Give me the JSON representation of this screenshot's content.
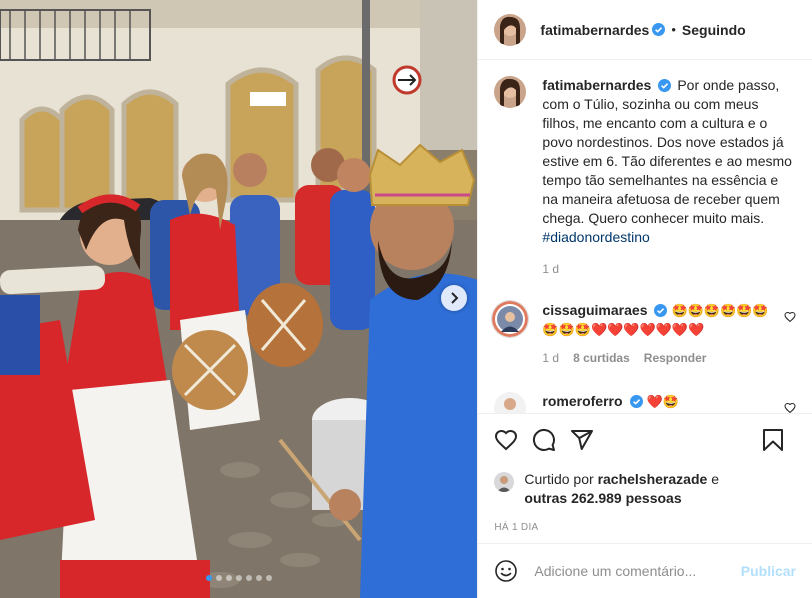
{
  "post": {
    "author": "fatimabernardes",
    "separator": "•",
    "follow_label": "Seguindo",
    "caption": {
      "text": "Por onde passo, com o Túlio, sozinha ou com meus filhos, me encanto com a cultura e o povo nordestinos. Dos nove estados já estive em 6. Tão diferentes e ao mesmo tempo tão semelhantes na essência e na maneira afetuosa de receber quem chega. Quero conhecer muito mais.",
      "hashtag": "#diadonordestino",
      "time": "1 d"
    },
    "comments": [
      {
        "user": "cissaguimaraes",
        "text": "🤩🤩🤩🤩🤩🤩🤩🤩🤩❤️❤️❤️❤️❤️❤️❤️",
        "time": "1 d",
        "likes": "8 curtidas",
        "reply": "Responder"
      },
      {
        "user": "romeroferro",
        "text": "❤️🤩"
      }
    ],
    "liked_by_prefix": "Curtido por",
    "liked_by_user": "rachelsherazade",
    "liked_by_and": "e",
    "liked_by_others": "outras 262.989 pessoas",
    "timestamp": "HÁ 1 DIA",
    "comment_placeholder": "Adicione um comentário...",
    "publish_label": "Publicar",
    "carousel": {
      "count": 7,
      "active_index": 0
    }
  },
  "colors": {
    "verified": "#3897f0",
    "link": "#00376b",
    "muted": "#8e8e8e",
    "publish_disabled": "#b2dffc",
    "heart": "#ed4956"
  },
  "icons": [
    "verified-icon",
    "heart-icon",
    "comment-icon",
    "share-icon",
    "bookmark-icon",
    "emoji-icon",
    "chevron-right-icon"
  ]
}
